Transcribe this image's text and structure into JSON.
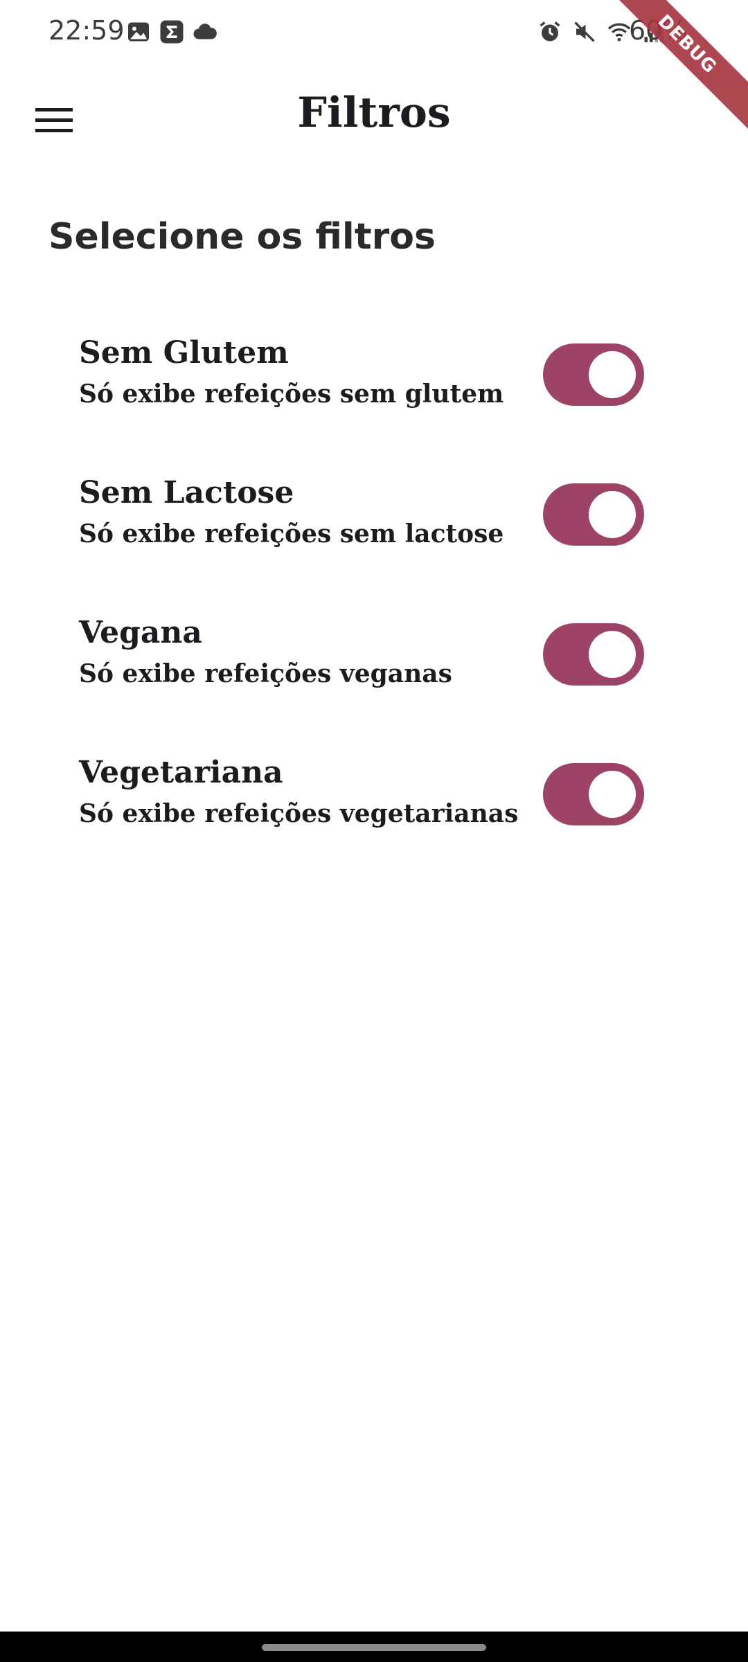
{
  "status_bar": {
    "time": "22:59",
    "battery": "60%",
    "left_icons": [
      "gallery-icon",
      "sigma-icon",
      "cloud-icon"
    ],
    "right_icons": [
      "alarm-icon",
      "mute-icon",
      "wifi-icon",
      "signal-icon"
    ]
  },
  "debug_banner": "DEBUG",
  "app_bar": {
    "title": "Filtros",
    "menu_icon": "hamburger-menu-icon"
  },
  "section_heading": "Selecione os filtros",
  "filters": [
    {
      "title": "Sem Glutem",
      "subtitle": "Só exibe refeições sem glutem",
      "enabled": true
    },
    {
      "title": "Sem Lactose",
      "subtitle": "Só exibe refeições sem lactose",
      "enabled": true
    },
    {
      "title": "Vegana",
      "subtitle": "Só exibe refeições veganas",
      "enabled": true
    },
    {
      "title": "Vegetariana",
      "subtitle": "Só exibe refeições vegetarianas",
      "enabled": true
    }
  ],
  "colors": {
    "switch_active": "#9c4366",
    "debug_banner": "#a6343c",
    "nav_bar": "#000000"
  }
}
